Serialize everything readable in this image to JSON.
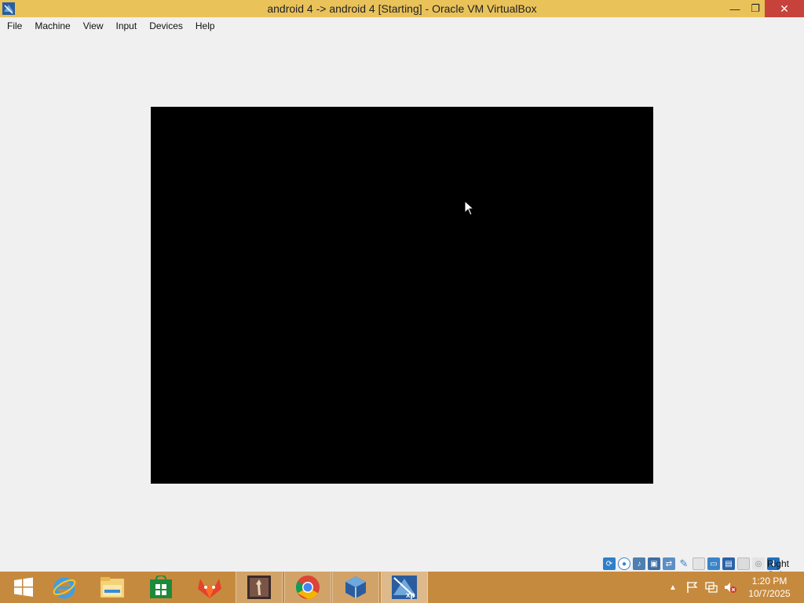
{
  "window": {
    "title": "android 4 -> android 4 [Starting] - Oracle VM VirtualBox",
    "minimize_glyph": "—",
    "maximize_glyph": "❐",
    "close_glyph": "✕"
  },
  "menu": {
    "items": [
      "File",
      "Machine",
      "View",
      "Input",
      "Devices",
      "Help"
    ]
  },
  "status_bar": {
    "icons": [
      "hard-disk-icon",
      "optical-drive-icon",
      "audio-icon",
      "network-icon",
      "usb-icon",
      "shared-folders-icon",
      "display-icon",
      "video-capture-icon",
      "mouse-integration-icon",
      "cpu-icon",
      "host-key-icon"
    ],
    "host_key": "Right Ctrl"
  },
  "taskbar": {
    "apps": [
      "start-icon",
      "internet-explorer-icon",
      "file-explorer-icon",
      "store-icon",
      "gitlab-icon",
      "media-app-icon",
      "chrome-icon",
      "virtualbox-manager-icon",
      "virtualbox-vm-icon"
    ],
    "clock_time": "1:20 PM",
    "clock_date": "10/7/2025"
  },
  "colors": {
    "titlebar": "#e9c25a",
    "taskbar": "#c68a3e",
    "close": "#c7423a",
    "vm_screen": "#000000"
  }
}
